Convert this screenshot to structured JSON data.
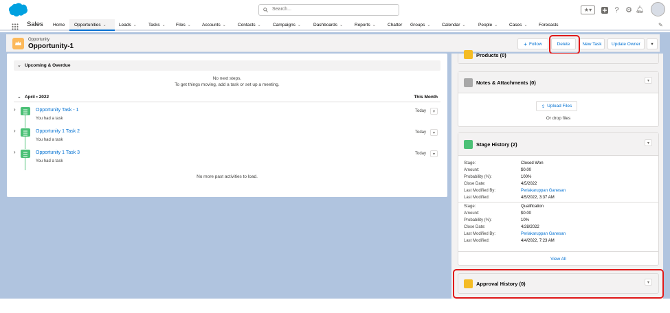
{
  "header": {
    "search_placeholder": "Search...",
    "app_name": "Sales",
    "nav_items": [
      {
        "label": "Home",
        "has_menu": false
      },
      {
        "label": "Opportunities",
        "has_menu": true,
        "active": true
      },
      {
        "label": "Leads",
        "has_menu": true
      },
      {
        "label": "Tasks",
        "has_menu": true
      },
      {
        "label": "Files",
        "has_menu": true
      },
      {
        "label": "Accounts",
        "has_menu": true
      },
      {
        "label": "Contacts",
        "has_menu": true
      },
      {
        "label": "Campaigns",
        "has_menu": true
      },
      {
        "label": "Dashboards",
        "has_menu": true
      },
      {
        "label": "Reports",
        "has_menu": true
      },
      {
        "label": "Chatter",
        "has_menu": false
      },
      {
        "label": "Groups",
        "has_menu": true
      },
      {
        "label": "Calendar",
        "has_menu": true
      },
      {
        "label": "People",
        "has_menu": true
      },
      {
        "label": "Cases",
        "has_menu": true
      },
      {
        "label": "Forecasts",
        "has_menu": false
      }
    ],
    "icons": [
      "favorites-icon",
      "add-icon",
      "help-icon",
      "setup-gear-icon",
      "notifications-bell-icon",
      "user-avatar"
    ]
  },
  "record": {
    "type_label": "Opportunity",
    "name": "Opportunity-1",
    "actions": {
      "follow": "Follow",
      "delete": "Delete",
      "new_task": "New Task",
      "update_owner": "Update Owner"
    }
  },
  "activity": {
    "upcoming_label": "Upcoming & Overdue",
    "no_next_steps": "No next steps.",
    "no_next_hint": "To get things moving, add a task or set up a meeting.",
    "month_label": "April • 2022",
    "month_right": "This Month",
    "tasks": [
      {
        "title": "Opportunity Task - 1",
        "subtitle": "You had a task",
        "date": "Today"
      },
      {
        "title": "Opportunity 1 Task 2",
        "subtitle": "You had a task",
        "date": "Today"
      },
      {
        "title": "Opportunity 1 Task 3",
        "subtitle": "You had a task",
        "date": "Today"
      }
    ],
    "no_more": "No more past activities to load."
  },
  "related": {
    "products_title": "Products (0)",
    "notes_title": "Notes & Attachments (0)",
    "upload_files": "Upload Files",
    "or_drop": "Or drop files",
    "stage_history_title": "Stage History (2)",
    "stage_history": [
      {
        "rows": [
          {
            "label": "Stage:",
            "value": "Closed Won"
          },
          {
            "label": "Amount:",
            "value": "$0.00"
          },
          {
            "label": "Probability (%):",
            "value": "100%"
          },
          {
            "label": "Close Date:",
            "value": "4/5/2022"
          },
          {
            "label": "Last Modified By:",
            "value": "Periakaruppan Ganesan",
            "link": true
          },
          {
            "label": "Last Modified:",
            "value": "4/5/2022, 3:37 AM"
          }
        ]
      },
      {
        "rows": [
          {
            "label": "Stage:",
            "value": "Qualification"
          },
          {
            "label": "Amount:",
            "value": "$0.00"
          },
          {
            "label": "Probability (%):",
            "value": "10%"
          },
          {
            "label": "Close Date:",
            "value": "4/28/2022"
          },
          {
            "label": "Last Modified By:",
            "value": "Periakaruppan Ganesan",
            "link": true
          },
          {
            "label": "Last Modified:",
            "value": "4/4/2022, 7:23 AM"
          }
        ]
      }
    ],
    "view_all": "View All",
    "approval_title": "Approval History (0)"
  },
  "colors": {
    "brand_blue": "#0070d2",
    "highlight_red": "#e01818",
    "task_green": "#4bc076",
    "opportunity_orange": "#fcb95b",
    "stage_history_green": "#4bc076",
    "notes_gray": "#a8a8a8",
    "approval_yellow": "#f4bc25"
  }
}
